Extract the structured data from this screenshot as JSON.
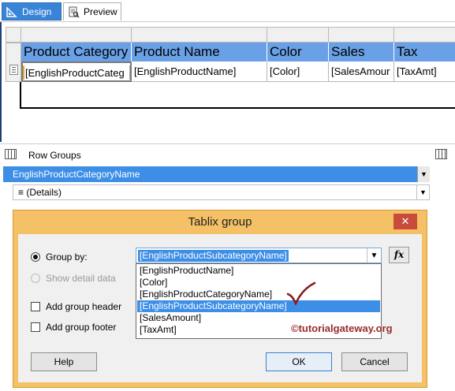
{
  "tabs": {
    "design": "Design",
    "preview": "Preview"
  },
  "tablix": {
    "headers": [
      "Product Category",
      "Product Name",
      "Color",
      "Sales",
      "Tax"
    ],
    "cells": [
      "[EnglishProductCateg",
      "[EnglishProductName]",
      "[Color]",
      "[SalesAmour",
      "[TaxAmt]"
    ]
  },
  "row_groups": {
    "title": "Row Groups",
    "groups": [
      "EnglishProductCategoryName",
      "≡ (Details)"
    ]
  },
  "dialog": {
    "title": "Tablix group",
    "close": "✕",
    "group_by_label": "Group by:",
    "show_detail_label": "Show detail data",
    "add_header_label": "Add group header",
    "add_footer_label": "Add group footer",
    "selected_value": "[EnglishProductSubcategoryName]",
    "fx_label": "fx",
    "options": [
      "[EnglishProductName]",
      "[Color]",
      "[EnglishProductCategoryName]",
      "[EnglishProductSubcategoryName]",
      "[SalesAmount]",
      "[TaxAmt]"
    ],
    "highlighted_index": 3,
    "help_label": "Help",
    "ok_label": "OK",
    "cancel_label": "Cancel"
  },
  "watermark": "©tutorialgateway.org",
  "colors": {
    "accent_blue": "#3d8ee6",
    "header_blue": "#6aa0e6",
    "dialog_frame": "#f5c167",
    "close_red": "#c94b3c"
  }
}
